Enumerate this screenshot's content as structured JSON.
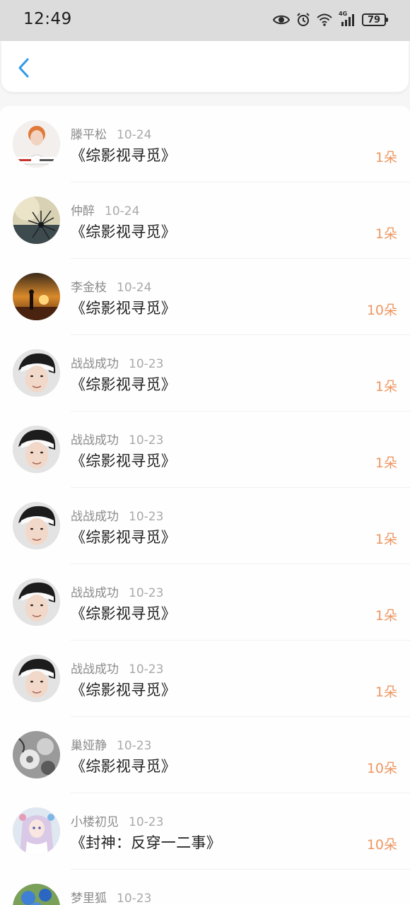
{
  "status_bar": {
    "time": "12:49",
    "battery": "79",
    "network": "4G",
    "icons": [
      "eye-icon",
      "alarm-icon",
      "wifi-icon",
      "signal-icon",
      "battery-icon"
    ]
  },
  "header": {
    "back_icon": "chevron-left-icon",
    "accent_color": "#2f9ae8"
  },
  "items": [
    {
      "name": "滕平松",
      "date": "10-24",
      "title": "《综影视寻觅》",
      "amount": "1朵",
      "avatar": "person-banner"
    },
    {
      "name": "仲醉",
      "date": "10-24",
      "title": "《综影视寻觅》",
      "amount": "1朵",
      "avatar": "dandelion"
    },
    {
      "name": "李金枝",
      "date": "10-24",
      "title": "《综影视寻觅》",
      "amount": "10朵",
      "avatar": "sunset-figure"
    },
    {
      "name": "战战成功",
      "date": "10-23",
      "title": "《综影视寻觅》",
      "amount": "1朵",
      "avatar": "headband-portrait"
    },
    {
      "name": "战战成功",
      "date": "10-23",
      "title": "《综影视寻觅》",
      "amount": "1朵",
      "avatar": "headband-portrait"
    },
    {
      "name": "战战成功",
      "date": "10-23",
      "title": "《综影视寻觅》",
      "amount": "1朵",
      "avatar": "headband-portrait"
    },
    {
      "name": "战战成功",
      "date": "10-23",
      "title": "《综影视寻觅》",
      "amount": "1朵",
      "avatar": "headband-portrait"
    },
    {
      "name": "战战成功",
      "date": "10-23",
      "title": "《综影视寻觅》",
      "amount": "1朵",
      "avatar": "headband-portrait"
    },
    {
      "name": "巢娅静",
      "date": "10-23",
      "title": "《综影视寻觅》",
      "amount": "10朵",
      "avatar": "grey-flowers"
    },
    {
      "name": "小楼初见",
      "date": "10-23",
      "title": "《封神：反穿一二事》",
      "amount": "10朵",
      "avatar": "anime-girl"
    },
    {
      "name": "梦里狐",
      "date": "10-23",
      "title": "",
      "amount": "",
      "avatar": "blue-flowers"
    }
  ],
  "colors": {
    "amount": "#ee9762",
    "name": "#8b8b8b",
    "title": "#202020"
  }
}
